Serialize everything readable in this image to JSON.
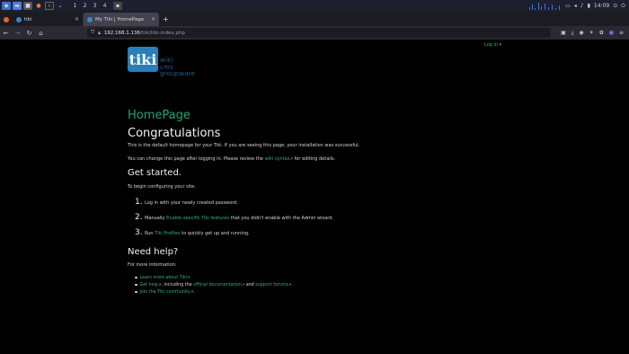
{
  "taskbar": {
    "workspaces": [
      "1",
      "2",
      "3",
      "4"
    ],
    "clock": "14:09"
  },
  "tabs": [
    {
      "label": "tiki",
      "active": false
    },
    {
      "label": "My Tiki | HomePage",
      "active": true
    }
  ],
  "nav": {
    "url_host": "192.168.1.136",
    "url_path": "/tiki/tiki-index.php"
  },
  "page": {
    "login_label": "Log in ▾",
    "logo": {
      "mark": "tiki",
      "words": [
        "wiki",
        "cms",
        "groupware"
      ]
    },
    "page_title": "HomePage",
    "heading": "Congratulations",
    "intro1": "This is the default homepage for your Tiki. If you are seeing this page, your installation was successful.",
    "intro2_pre": "You can change this page after logging in. Please review the ",
    "intro2_link": "wiki syntax",
    "intro2_post": " for editing details.",
    "get_started": "Get started.",
    "configure": "To begin configuring your site:",
    "steps": [
      {
        "num": "1.",
        "pre": "Log in with your newly created password.",
        "link": "",
        "post": ""
      },
      {
        "num": "2.",
        "pre": "Manually ",
        "link": "Enable specific Tiki features",
        "post": " that you didn't enable with the Admin wizard."
      },
      {
        "num": "3.",
        "pre": "Run ",
        "link": "Tiki Profiles",
        "post": " to quickly get up and running."
      }
    ],
    "need_help": "Need help?",
    "more_info": "For more information:",
    "links": {
      "learn_more": "Learn more about Tiki",
      "get_help": "Get help",
      "including": ", including the ",
      "official_docs": "official documentation",
      "and": " and ",
      "support_forums": "support forums",
      "join": "Join the Tiki community"
    }
  },
  "colors": {
    "accent": "#2fb07a",
    "background": "#000000"
  }
}
